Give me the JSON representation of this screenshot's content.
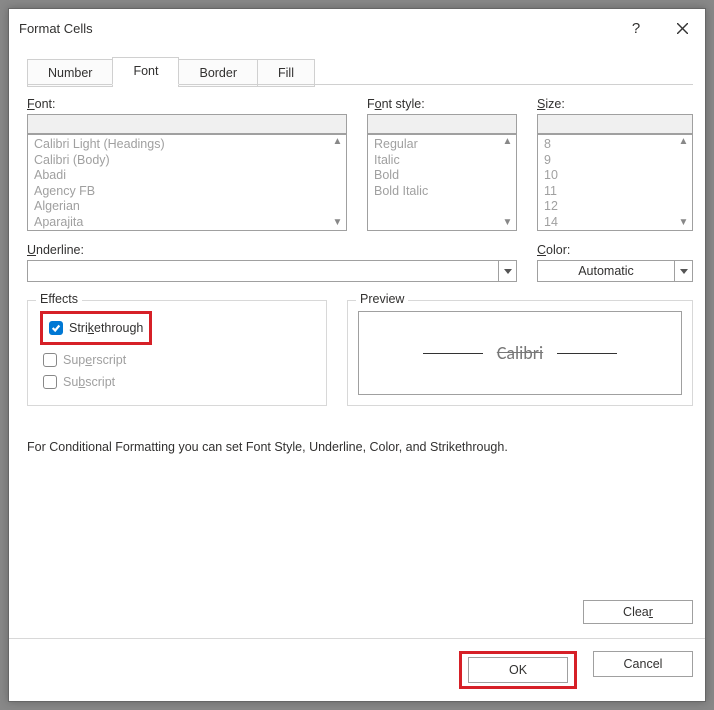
{
  "titlebar": {
    "title": "Format Cells"
  },
  "tabs": {
    "number": "Number",
    "font": "Font",
    "border": "Border",
    "fill": "Fill"
  },
  "font": {
    "label_prefix": "F",
    "label_rest": "ont:",
    "options": [
      "Calibri Light (Headings)",
      "Calibri (Body)",
      "Abadi",
      "Agency FB",
      "Algerian",
      "Aparajita"
    ]
  },
  "fontstyle": {
    "label_prefix": "F",
    "label_rest": "o",
    "label_rest2": "nt style:",
    "options": [
      "Regular",
      "Italic",
      "Bold",
      "Bold Italic"
    ]
  },
  "size": {
    "label_prefix": "S",
    "label_rest": "ize:",
    "options": [
      "8",
      "9",
      "10",
      "11",
      "12",
      "14"
    ]
  },
  "underline": {
    "label_prefix": "U",
    "label_rest": "nderline:",
    "value": ""
  },
  "color": {
    "label_prefix": "C",
    "label_rest": "olor:",
    "value": "Automatic"
  },
  "effects": {
    "group": "Effects",
    "strike_prefix": "Stri",
    "strike_u": "k",
    "strike_rest": "ethrough",
    "strike_checked": true,
    "super_prefix": "Sup",
    "super_u": "e",
    "super_rest": "rscript",
    "sub_prefix": "Su",
    "sub_u": "b",
    "sub_rest": "script"
  },
  "preview": {
    "group": "Preview",
    "text": "Calibri"
  },
  "note": "For Conditional Formatting you can set Font Style, Underline, Color, and Strikethrough.",
  "buttons": {
    "clear_prefix": "Clea",
    "clear_u": "r",
    "ok": "OK",
    "cancel": "Cancel"
  }
}
